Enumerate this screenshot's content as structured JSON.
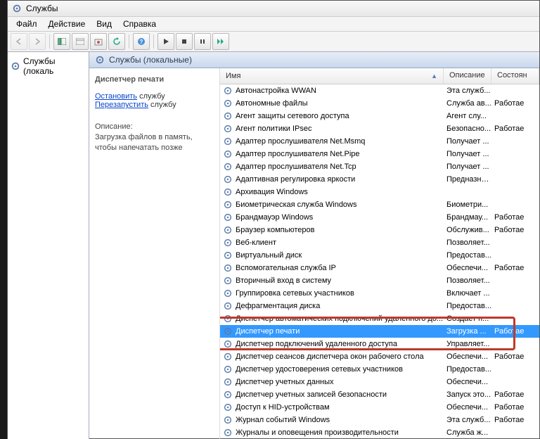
{
  "window_title": "Службы",
  "menu": {
    "file": "Файл",
    "action": "Действие",
    "view": "Вид",
    "help": "Справка"
  },
  "left_tree": {
    "root": "Службы (локаль"
  },
  "view_header": "Службы (локальные)",
  "detail": {
    "service_name": "Диспетчер печати",
    "stop_link": "Остановить",
    "stop_suffix": " службу",
    "restart_link": "Перезапустить",
    "restart_suffix": " службу",
    "desc_label": "Описание:",
    "desc_text": "Загрузка файлов в память, чтобы напечатать позже"
  },
  "columns": {
    "name": "Имя",
    "desc": "Описание",
    "state": "Состоян"
  },
  "rows": [
    {
      "name": "Автонастройка WWAN",
      "desc": "Эта служб...",
      "state": ""
    },
    {
      "name": "Автономные файлы",
      "desc": "Служба ав...",
      "state": "Работае"
    },
    {
      "name": "Агент защиты сетевого доступа",
      "desc": "Агент слу...",
      "state": ""
    },
    {
      "name": "Агент политики IPsec",
      "desc": "Безопасно...",
      "state": "Работае"
    },
    {
      "name": "Адаптер прослушивателя Net.Msmq",
      "desc": "Получает ...",
      "state": ""
    },
    {
      "name": "Адаптер прослушивателя Net.Pipe",
      "desc": "Получает ...",
      "state": ""
    },
    {
      "name": "Адаптер прослушивателя Net.Tcp",
      "desc": "Получает ...",
      "state": ""
    },
    {
      "name": "Адаптивная регулировка яркости",
      "desc": "Предназна...",
      "state": ""
    },
    {
      "name": "Архивация Windows",
      "desc": "",
      "state": ""
    },
    {
      "name": "Биометрическая служба Windows",
      "desc": "Биометри...",
      "state": ""
    },
    {
      "name": "Брандмауэр Windows",
      "desc": "Брандмау...",
      "state": "Работае"
    },
    {
      "name": "Браузер компьютеров",
      "desc": "Обслужив...",
      "state": "Работае"
    },
    {
      "name": "Веб-клиент",
      "desc": "Позволяет...",
      "state": ""
    },
    {
      "name": "Виртуальный диск",
      "desc": "Предостав...",
      "state": ""
    },
    {
      "name": "Вспомогательная служба IP",
      "desc": "Обеспечи...",
      "state": "Работае"
    },
    {
      "name": "Вторичный вход в систему",
      "desc": "Позволяет...",
      "state": ""
    },
    {
      "name": "Группировка сетевых участников",
      "desc": "Включает ...",
      "state": ""
    },
    {
      "name": "Дефрагментация диска",
      "desc": "Предостав...",
      "state": ""
    },
    {
      "name": "Диспетчер автоматических подключений удаленного до...",
      "desc": "Создает п...",
      "state": ""
    },
    {
      "name": "Диспетчер печати",
      "desc": "Загрузка ...",
      "state": "Работае",
      "selected": true,
      "highlight": true
    },
    {
      "name": "Диспетчер подключений удаленного доступа",
      "desc": "Управляет...",
      "state": ""
    },
    {
      "name": "Диспетчер сеансов диспетчера окон рабочего стола",
      "desc": "Обеспечи...",
      "state": "Работае"
    },
    {
      "name": "Диспетчер удостоверения сетевых участников",
      "desc": "Предостав...",
      "state": ""
    },
    {
      "name": "Диспетчер учетных данных",
      "desc": "Обеспечи...",
      "state": ""
    },
    {
      "name": "Диспетчер учетных записей безопасности",
      "desc": "Запуск это...",
      "state": "Работае"
    },
    {
      "name": "Доступ к HID-устройствам",
      "desc": "Обеспечи...",
      "state": "Работае"
    },
    {
      "name": "Журнал событий Windows",
      "desc": "Эта служб...",
      "state": "Работае"
    },
    {
      "name": "Журналы и оповещения производительности",
      "desc": "Служба ж...",
      "state": ""
    }
  ]
}
